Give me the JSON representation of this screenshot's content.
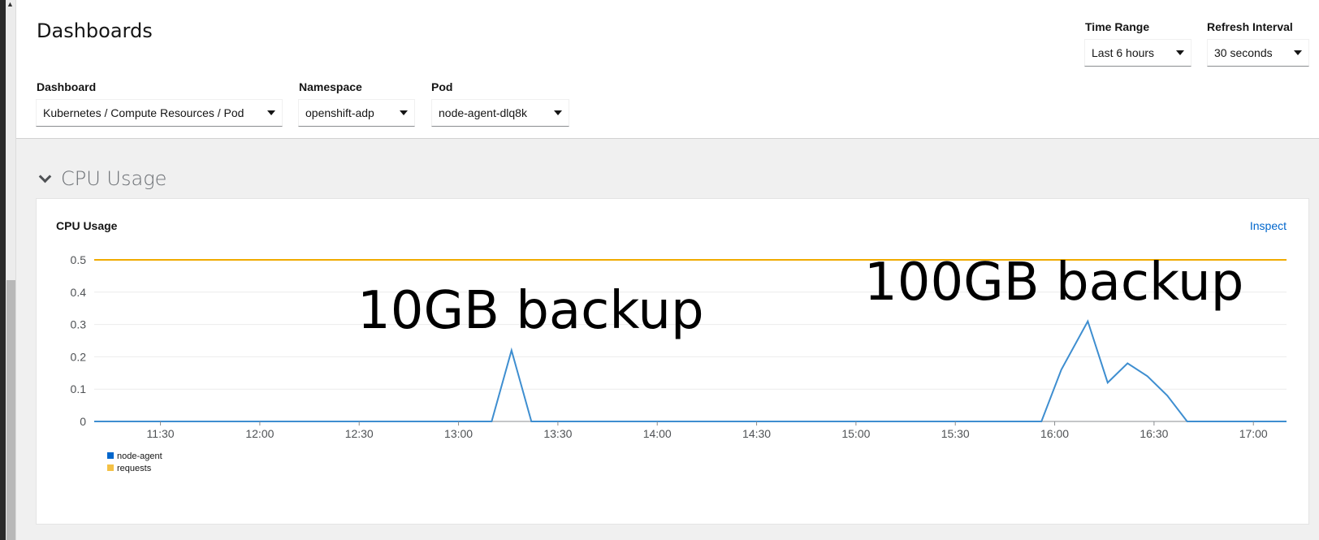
{
  "header": {
    "title": "Dashboards",
    "time_range": {
      "label": "Time Range",
      "value": "Last 6 hours"
    },
    "refresh_interval": {
      "label": "Refresh Interval",
      "value": "30 seconds"
    },
    "dashboard": {
      "label": "Dashboard",
      "value": "Kubernetes / Compute Resources / Pod"
    },
    "namespace": {
      "label": "Namespace",
      "value": "openshift-adp"
    },
    "pod": {
      "label": "Pod",
      "value": "node-agent-dlq8k"
    }
  },
  "section": {
    "title": "CPU Usage"
  },
  "card": {
    "title": "CPU Usage",
    "inspect_label": "Inspect"
  },
  "annotations": {
    "first": "10GB backup",
    "second": "100GB backup"
  },
  "colors": {
    "node_agent": "#3e8ed0",
    "requests": "#f0ab00",
    "link": "#0066cc"
  },
  "chart_data": {
    "type": "line",
    "title": "CPU Usage",
    "xlabel": "",
    "ylabel": "",
    "ylim": [
      0,
      0.5
    ],
    "xlim": [
      "11:10",
      "17:10"
    ],
    "yticks": [
      "0",
      "0.1",
      "0.2",
      "0.3",
      "0.4",
      "0.5"
    ],
    "xticks": [
      "11:30",
      "12:00",
      "12:30",
      "13:00",
      "13:30",
      "14:00",
      "14:30",
      "15:00",
      "15:30",
      "16:00",
      "16:30",
      "17:00"
    ],
    "grid": true,
    "legend": "bottom-left",
    "series": [
      {
        "name": "node-agent",
        "color": "#3e8ed0",
        "x": [
          "11:10",
          "13:10",
          "13:16",
          "13:22",
          "15:56",
          "16:02",
          "16:10",
          "16:16",
          "16:22",
          "16:28",
          "16:34",
          "16:40",
          "17:10"
        ],
        "values": [
          0,
          0,
          0.22,
          0,
          0,
          0.16,
          0.31,
          0.12,
          0.18,
          0.14,
          0.08,
          0,
          0
        ]
      },
      {
        "name": "requests",
        "color": "#f0ab00",
        "x": [
          "11:10",
          "17:10"
        ],
        "values": [
          0.5,
          0.5
        ]
      }
    ]
  }
}
